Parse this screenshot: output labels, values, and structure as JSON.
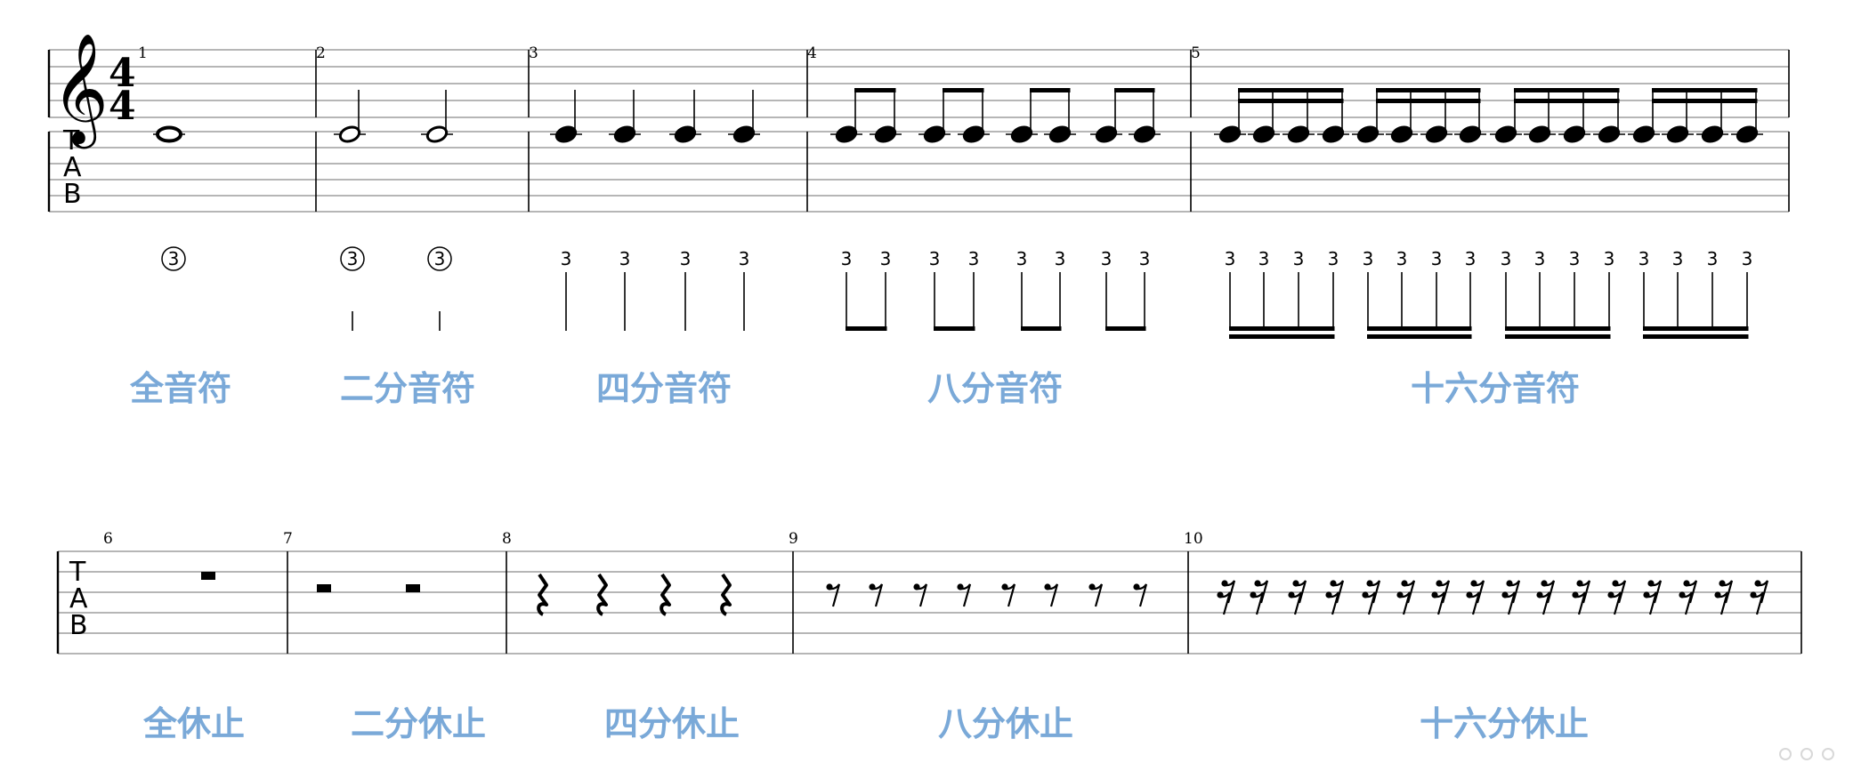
{
  "colors": {
    "label": "#7aa9d8",
    "ink": "#000000",
    "staff_line": "#8a8a8a"
  },
  "system1": {
    "time_signature": {
      "top": "4",
      "bottom": "4"
    },
    "tab_letters": [
      "T",
      "A",
      "B"
    ],
    "measures": [
      {
        "number": "1",
        "label": "全音符",
        "note": "whole",
        "count": 1,
        "fret": "③"
      },
      {
        "number": "2",
        "label": "二分音符",
        "note": "half",
        "count": 2,
        "fret": "③"
      },
      {
        "number": "3",
        "label": "四分音符",
        "note": "quarter",
        "count": 4,
        "fret": "3"
      },
      {
        "number": "4",
        "label": "八分音符",
        "note": "eighth",
        "count": 8,
        "fret": "3"
      },
      {
        "number": "5",
        "label": "十六分音符",
        "note": "sixteenth",
        "count": 16,
        "fret": "3"
      }
    ]
  },
  "system2": {
    "tab_letters": [
      "T",
      "A",
      "B"
    ],
    "measures": [
      {
        "number": "6",
        "label": "全休止",
        "rest": "whole",
        "count": 1
      },
      {
        "number": "7",
        "label": "二分休止",
        "rest": "half",
        "count": 2
      },
      {
        "number": "8",
        "label": "四分休止",
        "rest": "quarter",
        "count": 4
      },
      {
        "number": "9",
        "label": "八分休止",
        "rest": "eighth",
        "count": 8
      },
      {
        "number": "10",
        "label": "十六分休止",
        "rest": "sixteenth",
        "count": 16
      }
    ]
  },
  "watermark_icon": "watermark-dots-icon"
}
